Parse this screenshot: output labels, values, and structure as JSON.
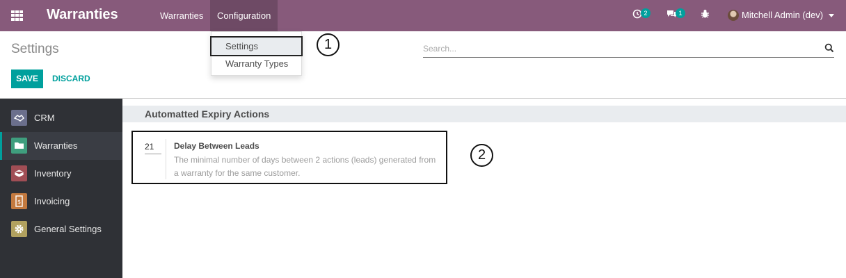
{
  "topbar": {
    "app_title": "Warranties",
    "menu": [
      "Warranties",
      "Configuration"
    ],
    "activity_count": "2",
    "message_count": "1",
    "user_name": "Mitchell Admin (dev)"
  },
  "config_menu": {
    "items": [
      "Settings",
      "Warranty Types"
    ]
  },
  "control_panel": {
    "title": "Settings",
    "search_placeholder": "Search...",
    "save_label": "SAVE",
    "discard_label": "DISCARD"
  },
  "sidebar": {
    "items": [
      {
        "label": "CRM",
        "icon": "handshake-icon",
        "color": "#6b6f8c"
      },
      {
        "label": "Warranties",
        "icon": "folder-icon",
        "color": "#3f9e7e"
      },
      {
        "label": "Inventory",
        "icon": "box-icon",
        "color": "#a04e55"
      },
      {
        "label": "Invoicing",
        "icon": "invoice-icon",
        "color": "#c47a3f"
      },
      {
        "label": "General Settings",
        "icon": "gear-icon",
        "color": "#b1a15f"
      }
    ]
  },
  "section": {
    "title": "Automatted Expiry Actions",
    "setting": {
      "value": "21",
      "label": "Delay Between Leads",
      "description": "The minimal number of days between 2 actions (leads) generated from a warranty for the same customer."
    }
  },
  "annotations": {
    "callout_1": "1",
    "callout_2": "2"
  },
  "colors": {
    "topbar": "#875a7b",
    "accent": "#00a09d",
    "sidebar": "#2f3136"
  }
}
